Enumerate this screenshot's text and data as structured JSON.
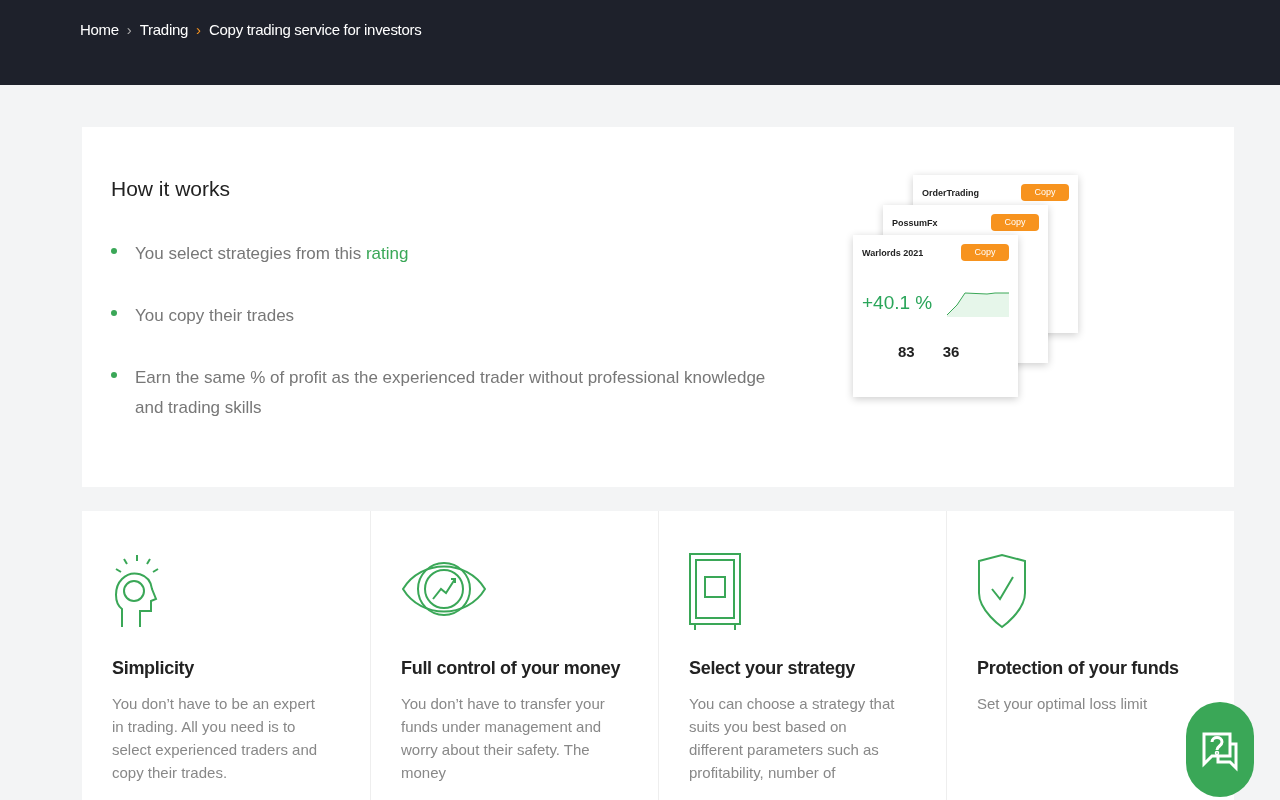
{
  "breadcrumb": [
    {
      "label": "Home"
    },
    {
      "separator": "›",
      "label": "Trading"
    },
    {
      "separator": "›",
      "label": "Copy trading service for investors"
    }
  ],
  "how_it_works": {
    "title": "How it works",
    "items": [
      {
        "text": "You select strategies from this ",
        "link": "rating"
      },
      {
        "text": "You copy their trades"
      },
      {
        "text": "Earn the same % of profit as the experienced trader without professional knowledge and trading skills"
      }
    ],
    "preview_cards": [
      {
        "name": "OrderTrading",
        "button": "Copy"
      },
      {
        "name": "PossumFx",
        "button": "Copy"
      },
      {
        "name": "Warlords 2021",
        "button": "Copy",
        "profit": "+40.1 %",
        "stat_1": "83",
        "stat_2": "36"
      }
    ]
  },
  "features": [
    {
      "kind": "brain",
      "title": "Simplicity",
      "text": "You don’t have to be an expert in trading. All you need is to select experienced traders and copy their trades."
    },
    {
      "kind": "eye",
      "title": "Full control of your money",
      "text": "You don’t have to transfer your funds under management and worry about their safety. The money"
    },
    {
      "kind": "safe",
      "title": "Select your strategy",
      "text": "You can choose a strategy that suits you best based on different parameters such as profitability, number of"
    },
    {
      "kind": "shield",
      "title": "Protection of your funds",
      "text": "Set your optimal loss limit"
    }
  ]
}
